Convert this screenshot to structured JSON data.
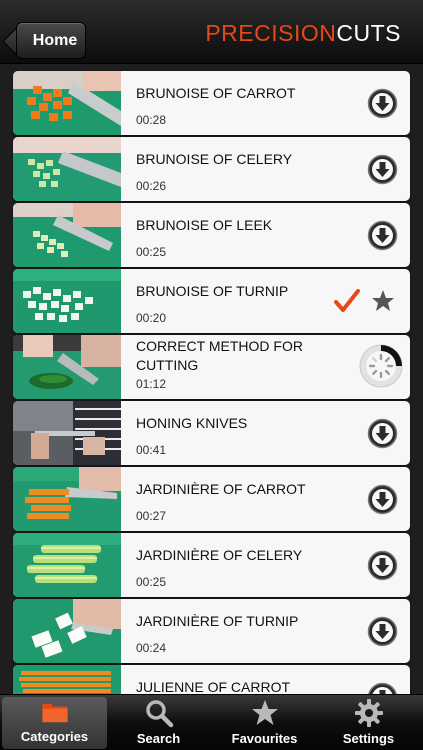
{
  "header": {
    "home_label": "Home",
    "brand_part1": "PRECISION",
    "brand_part2": "CUTS",
    "brand_accent_color": "#e64818"
  },
  "videos": [
    {
      "title": "BRUNOISE OF CARROT",
      "duration": "00:28",
      "action": "download-icon",
      "thumb": "carrot-dice"
    },
    {
      "title": "BRUNOISE OF CELERY",
      "duration": "00:26",
      "action": "download-icon",
      "thumb": "celery-dice"
    },
    {
      "title": "BRUNOISE OF LEEK",
      "duration": "00:25",
      "action": "download-icon",
      "thumb": "leek-dice"
    },
    {
      "title": "BRUNOISE OF TURNIP",
      "duration": "00:20",
      "action": "downloaded-favourite",
      "thumb": "turnip-dice"
    },
    {
      "title": "CORRECT METHOD FOR CUTTING",
      "duration": "01:12",
      "action": "downloading-spinner",
      "thumb": "herbs"
    },
    {
      "title": "HONING KNIVES",
      "duration": "00:41",
      "action": "download-icon",
      "thumb": "honing"
    },
    {
      "title": "JARDINIÈRE OF CARROT",
      "duration": "00:27",
      "action": "download-icon",
      "thumb": "carrot-sticks"
    },
    {
      "title": "JARDINIÈRE OF CELERY",
      "duration": "00:25",
      "action": "download-icon",
      "thumb": "celery-sticks"
    },
    {
      "title": "JARDINIÈRE OF TURNIP",
      "duration": "00:24",
      "action": "download-icon",
      "thumb": "turnip-sticks"
    },
    {
      "title": "JULIENNE OF CARROT",
      "duration": "",
      "action": "download-icon",
      "thumb": "carrot-julienne"
    }
  ],
  "tabs": [
    {
      "label": "Categories",
      "icon": "folder-icon",
      "active": true
    },
    {
      "label": "Search",
      "icon": "search-icon",
      "active": false
    },
    {
      "label": "Favourites",
      "icon": "star-icon",
      "active": false
    },
    {
      "label": "Settings",
      "icon": "gear-icon",
      "active": false
    }
  ]
}
